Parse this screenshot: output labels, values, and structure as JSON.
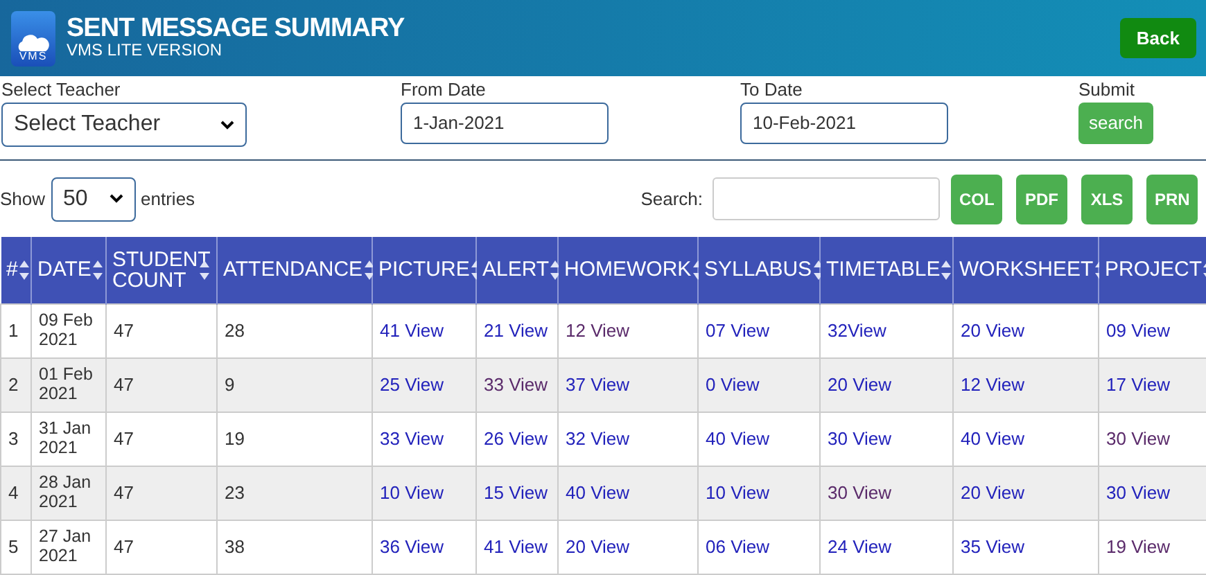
{
  "header": {
    "title": "SENT MESSAGE SUMMARY",
    "subtitle": "VMS LITE VERSION",
    "logo_text": "VMS",
    "back": "Back"
  },
  "filters": {
    "teacher_label": "Select Teacher",
    "teacher_value": "Select Teacher",
    "from_label": "From Date",
    "from_value": "1-Jan-2021",
    "to_label": "To Date",
    "to_value": "10-Feb-2021",
    "submit_label": "Submit",
    "submit_button": "search"
  },
  "table_tools": {
    "show": "Show",
    "entries_value": "50",
    "entries": "entries",
    "search_label": "Search:",
    "buttons": [
      "COL",
      "PDF",
      "XLS",
      "PRN"
    ]
  },
  "table": {
    "columns": [
      "#",
      "DATE",
      "STUDENT COUNT",
      "ATTENDANCE",
      "PICTURE",
      "ALERT",
      "HOMEWORK",
      "SYLLABUS",
      "TIMETABLE",
      "WORKSHEET",
      "PROJECT"
    ],
    "rows": [
      {
        "no": "1",
        "date": "09 Feb 2021",
        "student_count": "47",
        "attendance": "28",
        "links": [
          {
            "text": "41 View",
            "visited": false
          },
          {
            "text": "21 View",
            "visited": false
          },
          {
            "text": "12 View",
            "visited": true
          },
          {
            "text": "07 View",
            "visited": false
          },
          {
            "text": "32View",
            "visited": false
          },
          {
            "text": "20 View",
            "visited": false
          },
          {
            "text": "09 View",
            "visited": false
          }
        ]
      },
      {
        "no": "2",
        "date": "01 Feb 2021",
        "student_count": "47",
        "attendance": "9",
        "links": [
          {
            "text": "25 View",
            "visited": false
          },
          {
            "text": "33 View",
            "visited": true
          },
          {
            "text": "37 View",
            "visited": false
          },
          {
            "text": "0 View",
            "visited": false
          },
          {
            "text": "20 View",
            "visited": false
          },
          {
            "text": "12 View",
            "visited": false
          },
          {
            "text": "17 View",
            "visited": false
          }
        ]
      },
      {
        "no": "3",
        "date": "31 Jan 2021",
        "student_count": "47",
        "attendance": "19",
        "links": [
          {
            "text": "33 View",
            "visited": false
          },
          {
            "text": "26 View",
            "visited": false
          },
          {
            "text": "32 View",
            "visited": false
          },
          {
            "text": "40 View",
            "visited": false
          },
          {
            "text": "30 View",
            "visited": false
          },
          {
            "text": "40 View",
            "visited": false
          },
          {
            "text": "30 View",
            "visited": true
          }
        ]
      },
      {
        "no": "4",
        "date": "28 Jan 2021",
        "student_count": "47",
        "attendance": "23",
        "links": [
          {
            "text": "10 View",
            "visited": false
          },
          {
            "text": "15 View",
            "visited": false
          },
          {
            "text": "40 View",
            "visited": false
          },
          {
            "text": "10 View",
            "visited": false
          },
          {
            "text": "30 View",
            "visited": true
          },
          {
            "text": "20 View",
            "visited": false
          },
          {
            "text": "30 View",
            "visited": false
          }
        ]
      },
      {
        "no": "5",
        "date": "27 Jan 2021",
        "student_count": "47",
        "attendance": "38",
        "links": [
          {
            "text": "36 View",
            "visited": false
          },
          {
            "text": "41 View",
            "visited": false
          },
          {
            "text": "20 View",
            "visited": false
          },
          {
            "text": "06 View",
            "visited": false
          },
          {
            "text": "24 View",
            "visited": false
          },
          {
            "text": "35 View",
            "visited": false
          },
          {
            "text": "19 View",
            "visited": true
          }
        ]
      }
    ]
  }
}
